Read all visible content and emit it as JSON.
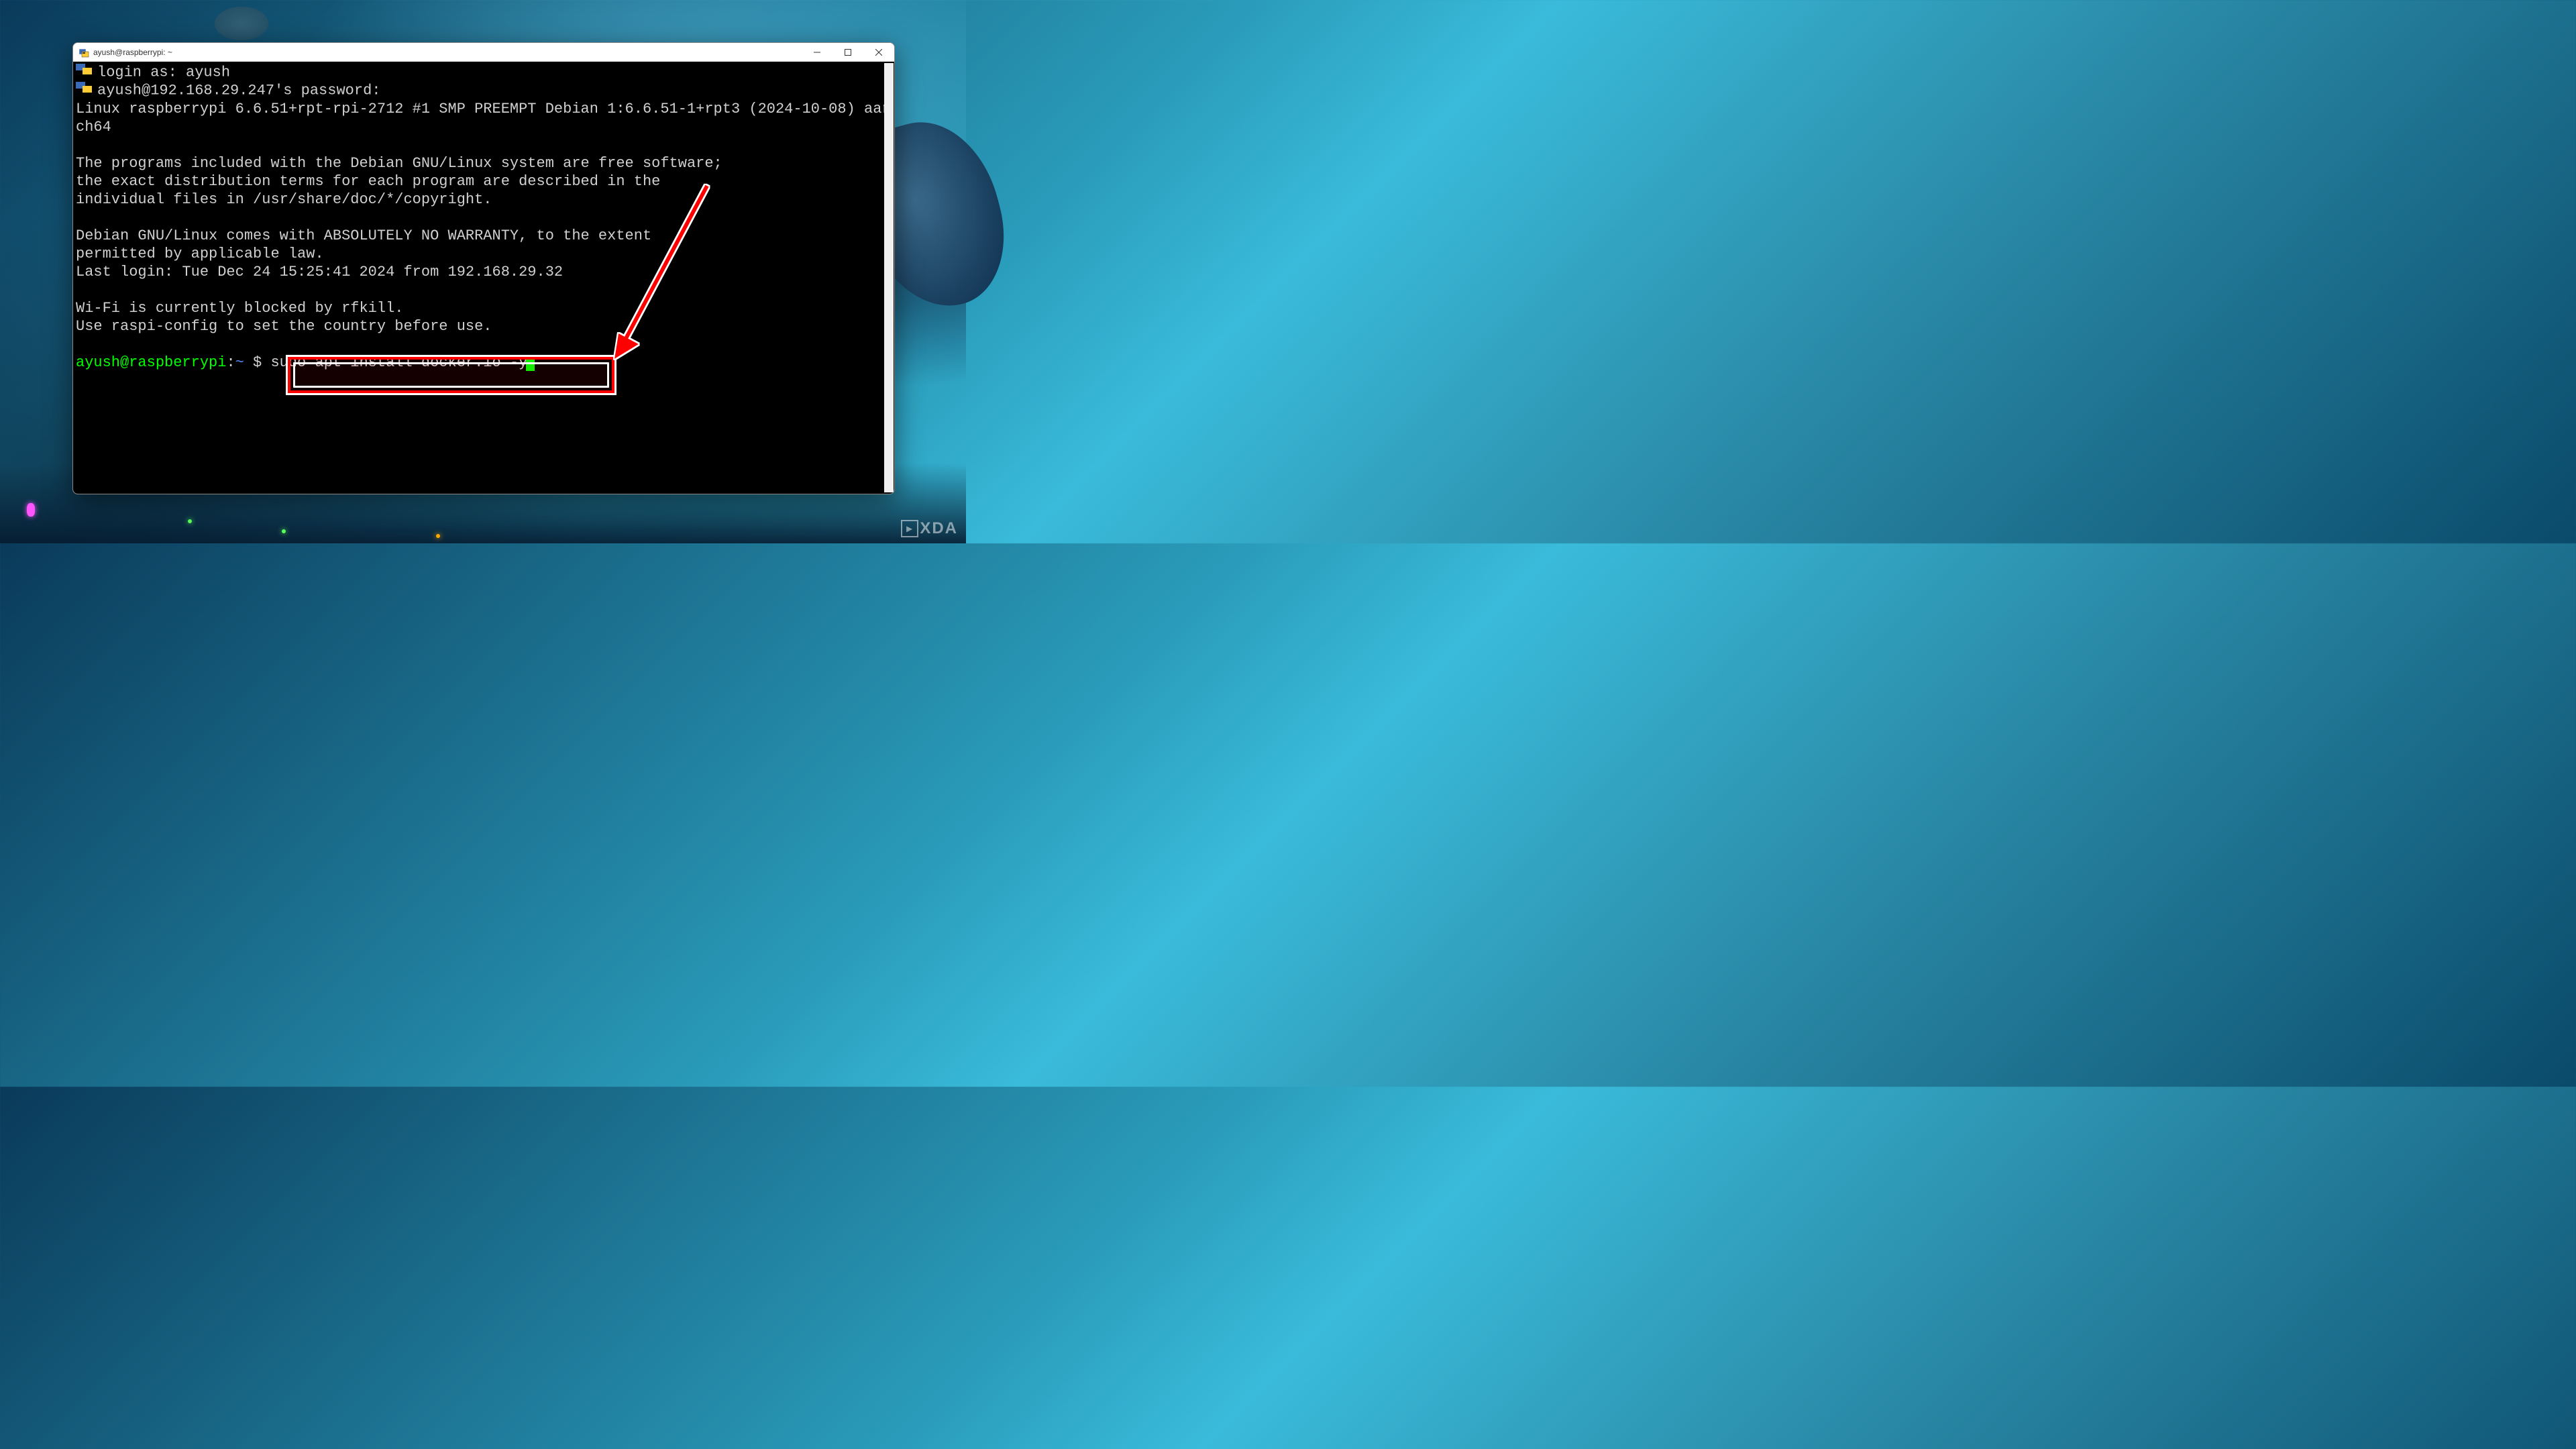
{
  "window": {
    "title": "ayush@raspberrypi: ~"
  },
  "terminal": {
    "login_prompt": "login as: ",
    "login_user": "ayush",
    "password_prompt": "ayush@192.168.29.247's password:",
    "system_line": "Linux raspberrypi 6.6.51+rpt-rpi-2712 #1 SMP PREEMPT Debian 1:6.6.51-1+rpt3 (2024-10-08) aarch64",
    "motd1": "The programs included with the Debian GNU/Linux system are free software;",
    "motd2": "the exact distribution terms for each program are described in the",
    "motd3": "individual files in /usr/share/doc/*/copyright.",
    "motd4": "Debian GNU/Linux comes with ABSOLUTELY NO WARRANTY, to the extent",
    "motd5": "permitted by applicable law.",
    "last_login": "Last login: Tue Dec 24 15:25:41 2024 from 192.168.29.32",
    "wifi1": "Wi-Fi is currently blocked by rfkill.",
    "wifi2": "Use raspi-config to set the country before use.",
    "prompt_user": "ayush@raspberrypi",
    "prompt_colon": ":",
    "prompt_path": "~",
    "prompt_dollar": " $ ",
    "command": "sudo apt install docker.io -y"
  },
  "icons": {
    "putty": "putty-icon",
    "terminal_small": "terminal-small-icon"
  },
  "annotation": {
    "arrow_color": "#ff0000",
    "highlight_color": "#ff0000"
  },
  "watermark": {
    "text": "XDA"
  }
}
